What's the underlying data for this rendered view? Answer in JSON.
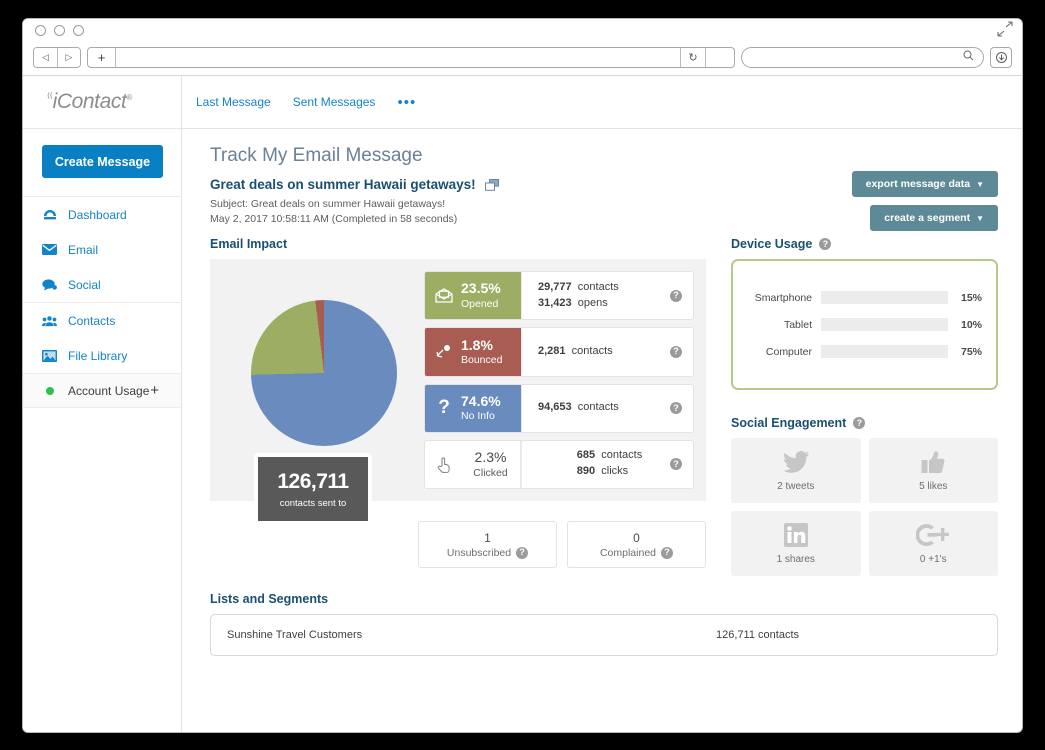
{
  "browser": {
    "back_icon": "◁",
    "forward_icon": "▷",
    "newtab_icon": "+",
    "reload_icon": "↻",
    "address_value": "",
    "search_value": "",
    "search_icon": "search-icon",
    "download_icon": "download-icon",
    "expand_icon": "fullscreen-icon"
  },
  "sidebar": {
    "logo": "iContact",
    "create_button": "Create Message",
    "items": [
      {
        "label": "Dashboard",
        "icon": "dashboard-icon"
      },
      {
        "label": "Email",
        "icon": "envelope-icon"
      },
      {
        "label": "Social",
        "icon": "chat-bubble-icon"
      },
      {
        "label": "Contacts",
        "icon": "people-icon"
      },
      {
        "label": "File Library",
        "icon": "image-icon"
      }
    ],
    "account_usage": {
      "label": "Account Usage",
      "plus": "+"
    }
  },
  "topnav": {
    "links": [
      "Last Message",
      "Sent Messages"
    ],
    "more": "•••"
  },
  "page": {
    "title": "Track My Email Message",
    "message_title": "Great deals on summer Hawaii getaways!",
    "subject": "Subject: Great deals on summer Hawaii getaways!",
    "date": "May 2, 2017 10:58:11 AM (Completed in 58 seconds)",
    "actions": [
      {
        "label": "export message data",
        "caret": "▼"
      },
      {
        "label": "create a segment",
        "caret": "▼"
      }
    ]
  },
  "email_impact": {
    "heading": "Email Impact",
    "metrics": [
      {
        "percent": "23.5%",
        "label": "Opened",
        "color": "#9cae63",
        "icon": "open-envelope-icon",
        "line1_num": "29,777",
        "line1_unit": "contacts",
        "line2_num": "31,423",
        "line2_unit": "opens",
        "help": "?"
      },
      {
        "percent": "1.8%",
        "label": "Bounced",
        "color": "#a85c52",
        "icon": "bounce-icon",
        "line1_num": "2,281",
        "line1_unit": "contacts",
        "line2_num": "",
        "line2_unit": "",
        "help": "?"
      },
      {
        "percent": "74.6%",
        "label": "No Info",
        "color": "#6a8bbd",
        "icon": "question-icon",
        "line1_num": "94,653",
        "line1_unit": "contacts",
        "line2_num": "",
        "line2_unit": "",
        "help": "?"
      },
      {
        "percent": "2.3%",
        "label": "Clicked",
        "color": "#ffffff",
        "icon": "pointer-hand-icon",
        "line1_num": "685",
        "line1_unit": "contacts",
        "line2_num": "890",
        "line2_unit": "clicks",
        "help": "?"
      }
    ],
    "sent": {
      "number": "126,711",
      "label": "contacts sent to"
    },
    "unsubscribed": {
      "number": "1",
      "label": "Unsubscribed",
      "help": "?"
    },
    "complained": {
      "number": "0",
      "label": "Complained",
      "help": "?"
    }
  },
  "chart_data": {
    "type": "pie",
    "title": "Email Impact",
    "categories": [
      "No Info",
      "Opened",
      "Bounced"
    ],
    "values": [
      74.6,
      23.5,
      1.8
    ],
    "colors": [
      "#6a8bbd",
      "#9cae63",
      "#a85c52"
    ],
    "unit": "percent",
    "legend": "inline-metrics"
  },
  "device_usage": {
    "heading": "Device Usage",
    "help": "?",
    "rows": [
      {
        "label": "Smartphone",
        "percent": 15,
        "percent_label": "15%"
      },
      {
        "label": "Tablet",
        "percent": 10,
        "percent_label": "10%"
      },
      {
        "label": "Computer",
        "percent": 75,
        "percent_label": "75%"
      }
    ]
  },
  "social": {
    "heading": "Social Engagement",
    "help": "?",
    "cards": [
      {
        "icon": "twitter-icon",
        "label": "2 tweets"
      },
      {
        "icon": "facebook-like-icon",
        "label": "5 likes"
      },
      {
        "icon": "linkedin-icon",
        "label": "1 shares"
      },
      {
        "icon": "google-plus-icon",
        "label": "0  +1's"
      }
    ]
  },
  "lists": {
    "heading": "Lists and Segments",
    "rows": [
      {
        "name": "Sunshine Travel Customers",
        "count": "126,711 contacts"
      }
    ]
  }
}
